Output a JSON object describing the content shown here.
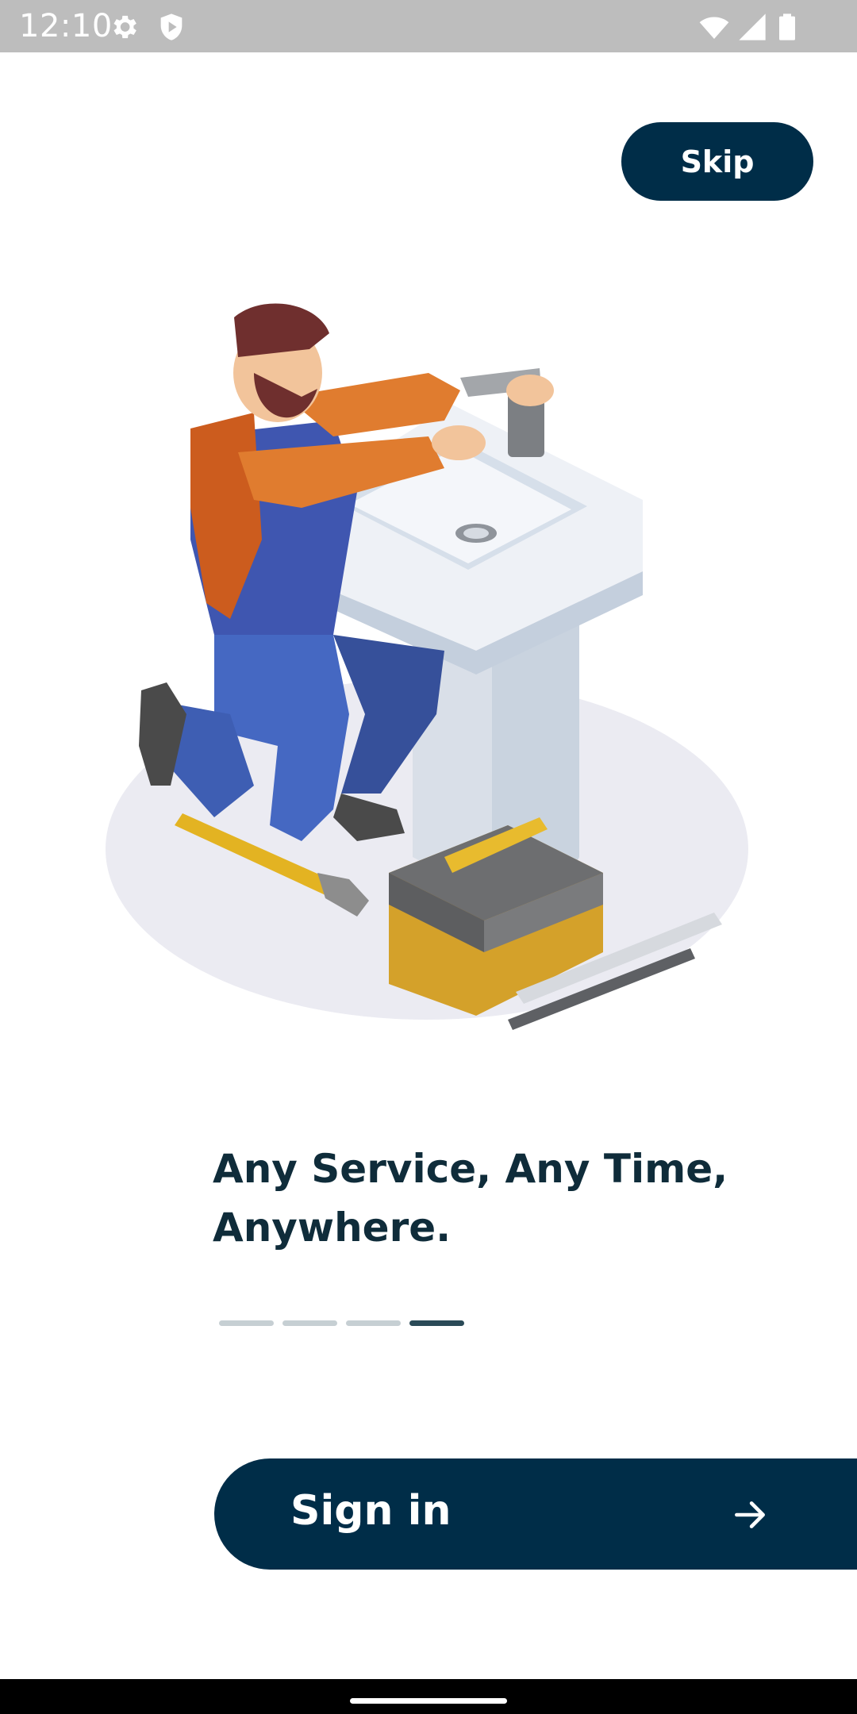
{
  "status_bar": {
    "time": "12:10",
    "left_icons": [
      "settings-icon",
      "play-protect-icon"
    ],
    "right_icons": [
      "wifi-icon",
      "signal-icon",
      "battery-icon"
    ]
  },
  "skip": {
    "label": "Skip"
  },
  "illustration": {
    "icon": "plumber-fixing-sink-illustration"
  },
  "headline": {
    "line1": "Any Service, Any Time,",
    "line2": "Anywhere."
  },
  "pager": {
    "total": 4,
    "active_index": 3
  },
  "signin": {
    "label": "Sign in",
    "icon": "arrow-right-icon"
  },
  "colors": {
    "primary": "#002d48",
    "headline": "#0f2c3a",
    "pager_inactive": "#c6cfd3",
    "pager_active": "#2a4a57",
    "status_bar": "#bdbdbd"
  }
}
